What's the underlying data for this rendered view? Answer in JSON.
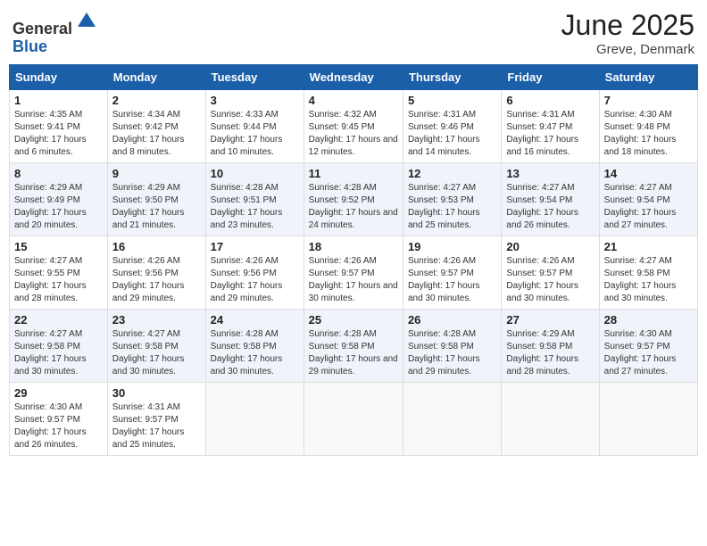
{
  "header": {
    "logo": {
      "line1": "General",
      "line2": "Blue"
    },
    "title": "June 2025",
    "location": "Greve, Denmark"
  },
  "calendar": {
    "days_of_week": [
      "Sunday",
      "Monday",
      "Tuesday",
      "Wednesday",
      "Thursday",
      "Friday",
      "Saturday"
    ],
    "weeks": [
      [
        {
          "day": "1",
          "sunrise": "4:35 AM",
          "sunset": "9:41 PM",
          "daylight": "17 hours and 6 minutes."
        },
        {
          "day": "2",
          "sunrise": "4:34 AM",
          "sunset": "9:42 PM",
          "daylight": "17 hours and 8 minutes."
        },
        {
          "day": "3",
          "sunrise": "4:33 AM",
          "sunset": "9:44 PM",
          "daylight": "17 hours and 10 minutes."
        },
        {
          "day": "4",
          "sunrise": "4:32 AM",
          "sunset": "9:45 PM",
          "daylight": "17 hours and 12 minutes."
        },
        {
          "day": "5",
          "sunrise": "4:31 AM",
          "sunset": "9:46 PM",
          "daylight": "17 hours and 14 minutes."
        },
        {
          "day": "6",
          "sunrise": "4:31 AM",
          "sunset": "9:47 PM",
          "daylight": "17 hours and 16 minutes."
        },
        {
          "day": "7",
          "sunrise": "4:30 AM",
          "sunset": "9:48 PM",
          "daylight": "17 hours and 18 minutes."
        }
      ],
      [
        {
          "day": "8",
          "sunrise": "4:29 AM",
          "sunset": "9:49 PM",
          "daylight": "17 hours and 20 minutes."
        },
        {
          "day": "9",
          "sunrise": "4:29 AM",
          "sunset": "9:50 PM",
          "daylight": "17 hours and 21 minutes."
        },
        {
          "day": "10",
          "sunrise": "4:28 AM",
          "sunset": "9:51 PM",
          "daylight": "17 hours and 23 minutes."
        },
        {
          "day": "11",
          "sunrise": "4:28 AM",
          "sunset": "9:52 PM",
          "daylight": "17 hours and 24 minutes."
        },
        {
          "day": "12",
          "sunrise": "4:27 AM",
          "sunset": "9:53 PM",
          "daylight": "17 hours and 25 minutes."
        },
        {
          "day": "13",
          "sunrise": "4:27 AM",
          "sunset": "9:54 PM",
          "daylight": "17 hours and 26 minutes."
        },
        {
          "day": "14",
          "sunrise": "4:27 AM",
          "sunset": "9:54 PM",
          "daylight": "17 hours and 27 minutes."
        }
      ],
      [
        {
          "day": "15",
          "sunrise": "4:27 AM",
          "sunset": "9:55 PM",
          "daylight": "17 hours and 28 minutes."
        },
        {
          "day": "16",
          "sunrise": "4:26 AM",
          "sunset": "9:56 PM",
          "daylight": "17 hours and 29 minutes."
        },
        {
          "day": "17",
          "sunrise": "4:26 AM",
          "sunset": "9:56 PM",
          "daylight": "17 hours and 29 minutes."
        },
        {
          "day": "18",
          "sunrise": "4:26 AM",
          "sunset": "9:57 PM",
          "daylight": "17 hours and 30 minutes."
        },
        {
          "day": "19",
          "sunrise": "4:26 AM",
          "sunset": "9:57 PM",
          "daylight": "17 hours and 30 minutes."
        },
        {
          "day": "20",
          "sunrise": "4:26 AM",
          "sunset": "9:57 PM",
          "daylight": "17 hours and 30 minutes."
        },
        {
          "day": "21",
          "sunrise": "4:27 AM",
          "sunset": "9:58 PM",
          "daylight": "17 hours and 30 minutes."
        }
      ],
      [
        {
          "day": "22",
          "sunrise": "4:27 AM",
          "sunset": "9:58 PM",
          "daylight": "17 hours and 30 minutes."
        },
        {
          "day": "23",
          "sunrise": "4:27 AM",
          "sunset": "9:58 PM",
          "daylight": "17 hours and 30 minutes."
        },
        {
          "day": "24",
          "sunrise": "4:28 AM",
          "sunset": "9:58 PM",
          "daylight": "17 hours and 30 minutes."
        },
        {
          "day": "25",
          "sunrise": "4:28 AM",
          "sunset": "9:58 PM",
          "daylight": "17 hours and 29 minutes."
        },
        {
          "day": "26",
          "sunrise": "4:28 AM",
          "sunset": "9:58 PM",
          "daylight": "17 hours and 29 minutes."
        },
        {
          "day": "27",
          "sunrise": "4:29 AM",
          "sunset": "9:58 PM",
          "daylight": "17 hours and 28 minutes."
        },
        {
          "day": "28",
          "sunrise": "4:30 AM",
          "sunset": "9:57 PM",
          "daylight": "17 hours and 27 minutes."
        }
      ],
      [
        {
          "day": "29",
          "sunrise": "4:30 AM",
          "sunset": "9:57 PM",
          "daylight": "17 hours and 26 minutes."
        },
        {
          "day": "30",
          "sunrise": "4:31 AM",
          "sunset": "9:57 PM",
          "daylight": "17 hours and 25 minutes."
        },
        null,
        null,
        null,
        null,
        null
      ]
    ]
  }
}
